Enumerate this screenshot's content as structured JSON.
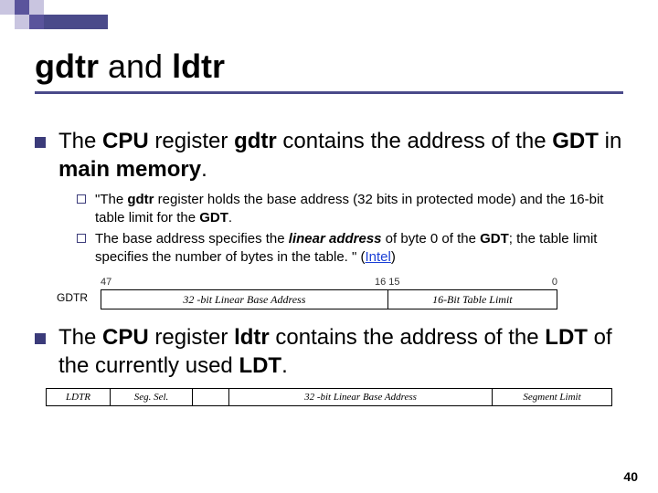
{
  "title": {
    "t1": "gdtr",
    "t2": " and ",
    "t3": "ldtr"
  },
  "p1": {
    "a": "The ",
    "b": "CPU",
    "c": " register ",
    "d": "gdtr",
    "e": " contains the address of the ",
    "f": "GDT",
    "g": " in ",
    "h": "main memory",
    "i": "."
  },
  "sub1": {
    "a": "\"The ",
    "b": "gdtr",
    "c": " register holds the base address (32 bits in protected mode) and the 16-bit table limit for the ",
    "d": "GDT",
    "e": "."
  },
  "sub2": {
    "a": "The base address specifies the ",
    "b": "linear address",
    "c": " of byte 0 of the ",
    "d": "GDT",
    "e": "; the table limit specifies the number of bytes in the table. \" (",
    "f": "Intel",
    "g": ")"
  },
  "diagram1": {
    "tick47": "47",
    "tick1615": "16 15",
    "tick0": "0",
    "gdtr": "GDTR",
    "base": "32 -bit Linear Base Address",
    "limit": "16-Bit Table Limit"
  },
  "p2": {
    "a": "The ",
    "b": "CPU",
    "c": " register ",
    "d": "ldtr",
    "e": " contains the address of the ",
    "f": "LDT",
    "g": " of the currently used ",
    "h": "LDT",
    "i": "."
  },
  "diagram2": {
    "a": "LDTR",
    "b": "Seg. Sel.",
    "d": "32 -bit Linear Base Address",
    "e": "Segment Limit"
  },
  "pagenum": "40"
}
